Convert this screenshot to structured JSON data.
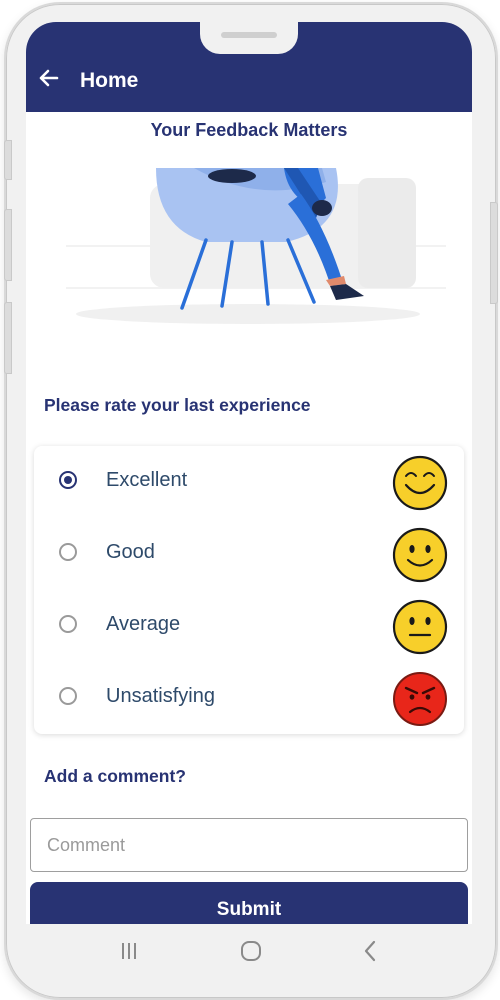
{
  "appbar": {
    "title": "Home",
    "back_icon": "arrow-left-icon"
  },
  "header": {
    "title": "Your Feedback Matters"
  },
  "rating": {
    "prompt": "Please rate your last experience",
    "selected": "Excellent",
    "options": [
      {
        "label": "Excellent",
        "icon": "grinning-face-icon",
        "checked": true
      },
      {
        "label": "Good",
        "icon": "smiling-face-icon",
        "checked": false
      },
      {
        "label": "Average",
        "icon": "neutral-face-icon",
        "checked": false
      },
      {
        "label": "Unsatisfying",
        "icon": "angry-face-icon",
        "checked": false
      }
    ]
  },
  "comment": {
    "title": "Add a comment?",
    "placeholder": "Comment",
    "value": ""
  },
  "submit": {
    "label": "Submit"
  },
  "navbar": {
    "items": [
      "recent-apps-icon",
      "home-icon",
      "back-icon"
    ]
  },
  "colors": {
    "primary": "#283373",
    "text": "#2e4a6a",
    "chair": "#a9c3f2",
    "legs": "#2a6fd8"
  }
}
